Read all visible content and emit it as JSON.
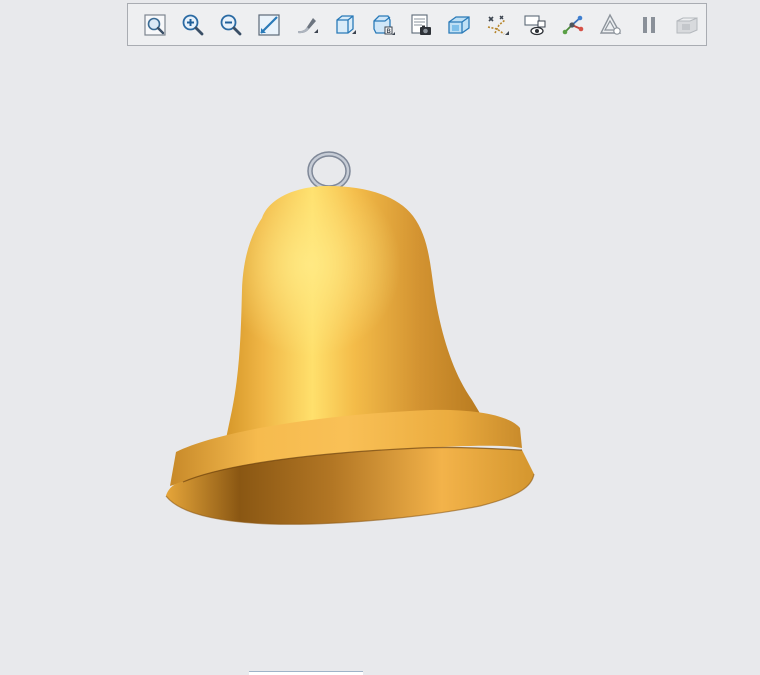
{
  "toolbar": {
    "buttons": [
      {
        "icon": "refit-icon"
      },
      {
        "icon": "zoom-in-icon"
      },
      {
        "icon": "zoom-out-icon"
      },
      {
        "icon": "repaint-icon"
      },
      {
        "icon": "reorient-icon"
      },
      {
        "icon": "saved-orientations-icon"
      },
      {
        "icon": "view-manager-icon"
      },
      {
        "icon": "display-style-icon"
      },
      {
        "icon": "section-view-icon"
      },
      {
        "icon": "datum-display-icon"
      },
      {
        "icon": "annotation-display-icon"
      },
      {
        "icon": "spin-center-icon"
      },
      {
        "icon": "appearance-icon"
      },
      {
        "icon": "pause-icon"
      },
      {
        "icon": "disabled-icon"
      }
    ]
  },
  "model": {
    "name": "bell",
    "colors": {
      "body": "#e8ad3d",
      "highlight": "#ffe577",
      "shadow": "#9c6416",
      "clapper": "#f4f0b0",
      "ring": "#9aa4b4"
    }
  },
  "colors": {
    "background": "#e8e9ec",
    "toolbar_bg": "#eeeff1",
    "toolbar_border": "#a9acb2",
    "icon_blue": "#2a7ab8"
  }
}
